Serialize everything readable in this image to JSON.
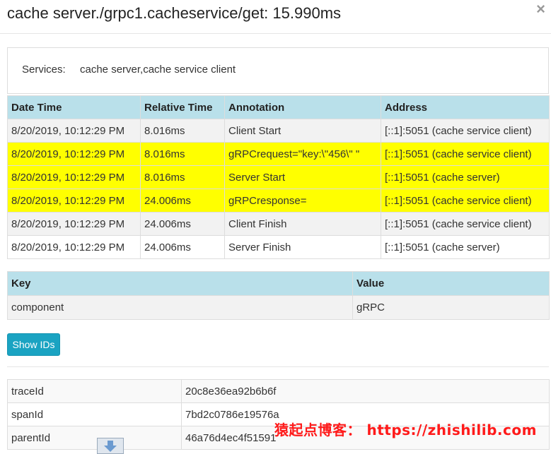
{
  "header": {
    "title": "cache server./grpc1.cacheservice/get: 15.990ms",
    "close_symbol": "×"
  },
  "services": {
    "label": "Services:",
    "value": "cache server,cache service client"
  },
  "span_table": {
    "columns": [
      "Date Time",
      "Relative Time",
      "Annotation",
      "Address"
    ],
    "rows": [
      {
        "date": "8/20/2019, 10:12:29 PM",
        "relative": "8.016ms",
        "annotation": "Client Start",
        "address": "[::1]:5051 (cache service client)",
        "highlighted": false
      },
      {
        "date": "8/20/2019, 10:12:29 PM",
        "relative": "8.016ms",
        "annotation": "gRPCrequest=\"key:\\\"456\\\" \"",
        "address": "[::1]:5051 (cache service client)",
        "highlighted": true
      },
      {
        "date": "8/20/2019, 10:12:29 PM",
        "relative": "8.016ms",
        "annotation": "Server Start",
        "address": "[::1]:5051 (cache server)",
        "highlighted": true
      },
      {
        "date": "8/20/2019, 10:12:29 PM",
        "relative": "24.006ms",
        "annotation": "gRPCresponse=",
        "address": "[::1]:5051 (cache service client)",
        "highlighted": true
      },
      {
        "date": "8/20/2019, 10:12:29 PM",
        "relative": "24.006ms",
        "annotation": "Client Finish",
        "address": "[::1]:5051 (cache service client)",
        "highlighted": false
      },
      {
        "date": "8/20/2019, 10:12:29 PM",
        "relative": "24.006ms",
        "annotation": "Server Finish",
        "address": "[::1]:5051 (cache server)",
        "highlighted": false
      }
    ],
    "highlight_color": "#ffff00",
    "header_color": "#b9e0ea"
  },
  "tag_table": {
    "columns": [
      "Key",
      "Value"
    ],
    "rows": [
      {
        "key": "component",
        "value": "gRPC"
      }
    ]
  },
  "show_ids_button": {
    "label": "Show IDs",
    "color": "#1aa3c2"
  },
  "id_table": {
    "rows": [
      {
        "key": "traceId",
        "value": "20c8e36ea92b6b6f"
      },
      {
        "key": "spanId",
        "value": "7bd2c0786e19576a"
      },
      {
        "key": "parentId",
        "value": "46a76d4ec4f51591"
      }
    ]
  },
  "watermark": {
    "text": "猿起点博客： https://zhishilib.com",
    "color": "#ff1a1a"
  },
  "scroll_icon": "down-arrow-icon"
}
